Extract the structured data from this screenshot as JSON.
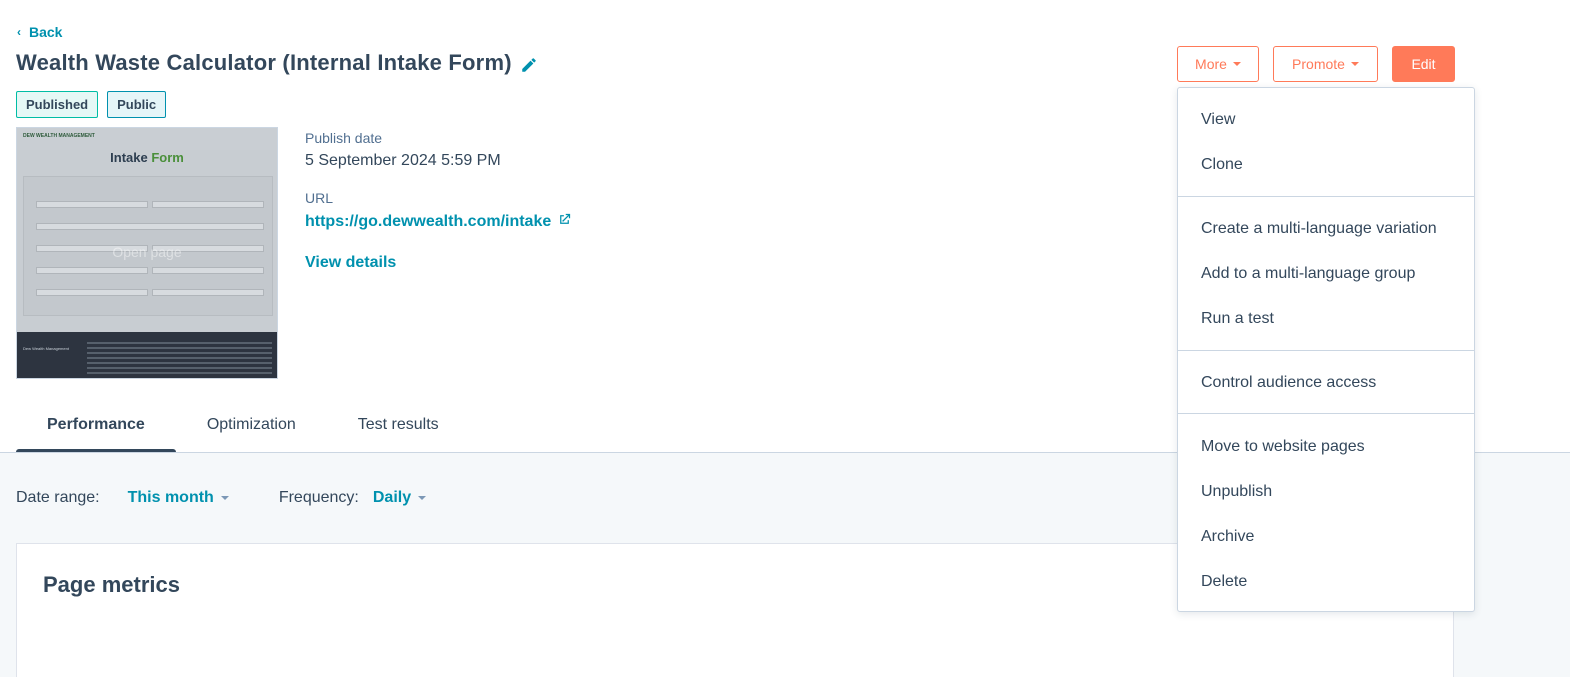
{
  "header": {
    "back_label": "Back",
    "title": "Wealth Waste Calculator (Internal Intake Form)",
    "badges": [
      "Published",
      "Public"
    ]
  },
  "thumbnail": {
    "logo_text": "DEW WEALTH MANAGEMENT",
    "form_title_a": "Intake",
    "form_title_b": "Form",
    "overlay_text": "Open page",
    "footer_logo": "Dew Wealth Management"
  },
  "meta": {
    "publish_label": "Publish date",
    "publish_value": "5 September 2024 5:59 PM",
    "url_label": "URL",
    "url_value": "https://go.dewwealth.com/intake",
    "details_label": "View details"
  },
  "actions": {
    "more_label": "More",
    "promote_label": "Promote",
    "edit_label": "Edit"
  },
  "menu": {
    "items": [
      "View",
      "Clone",
      "Create a multi-language variation",
      "Add to a multi-language group",
      "Run a test",
      "Control audience access",
      "Move to website pages",
      "Unpublish",
      "Archive",
      "Delete"
    ]
  },
  "tabs": [
    "Performance",
    "Optimization",
    "Test results"
  ],
  "filters": {
    "date_label": "Date range:",
    "date_value": "This month",
    "freq_label": "Frequency:",
    "freq_value": "Daily"
  },
  "card": {
    "title": "Page metrics"
  },
  "colors": {
    "accent": "#ff7a59",
    "link": "#0091ae",
    "text": "#33475b"
  }
}
